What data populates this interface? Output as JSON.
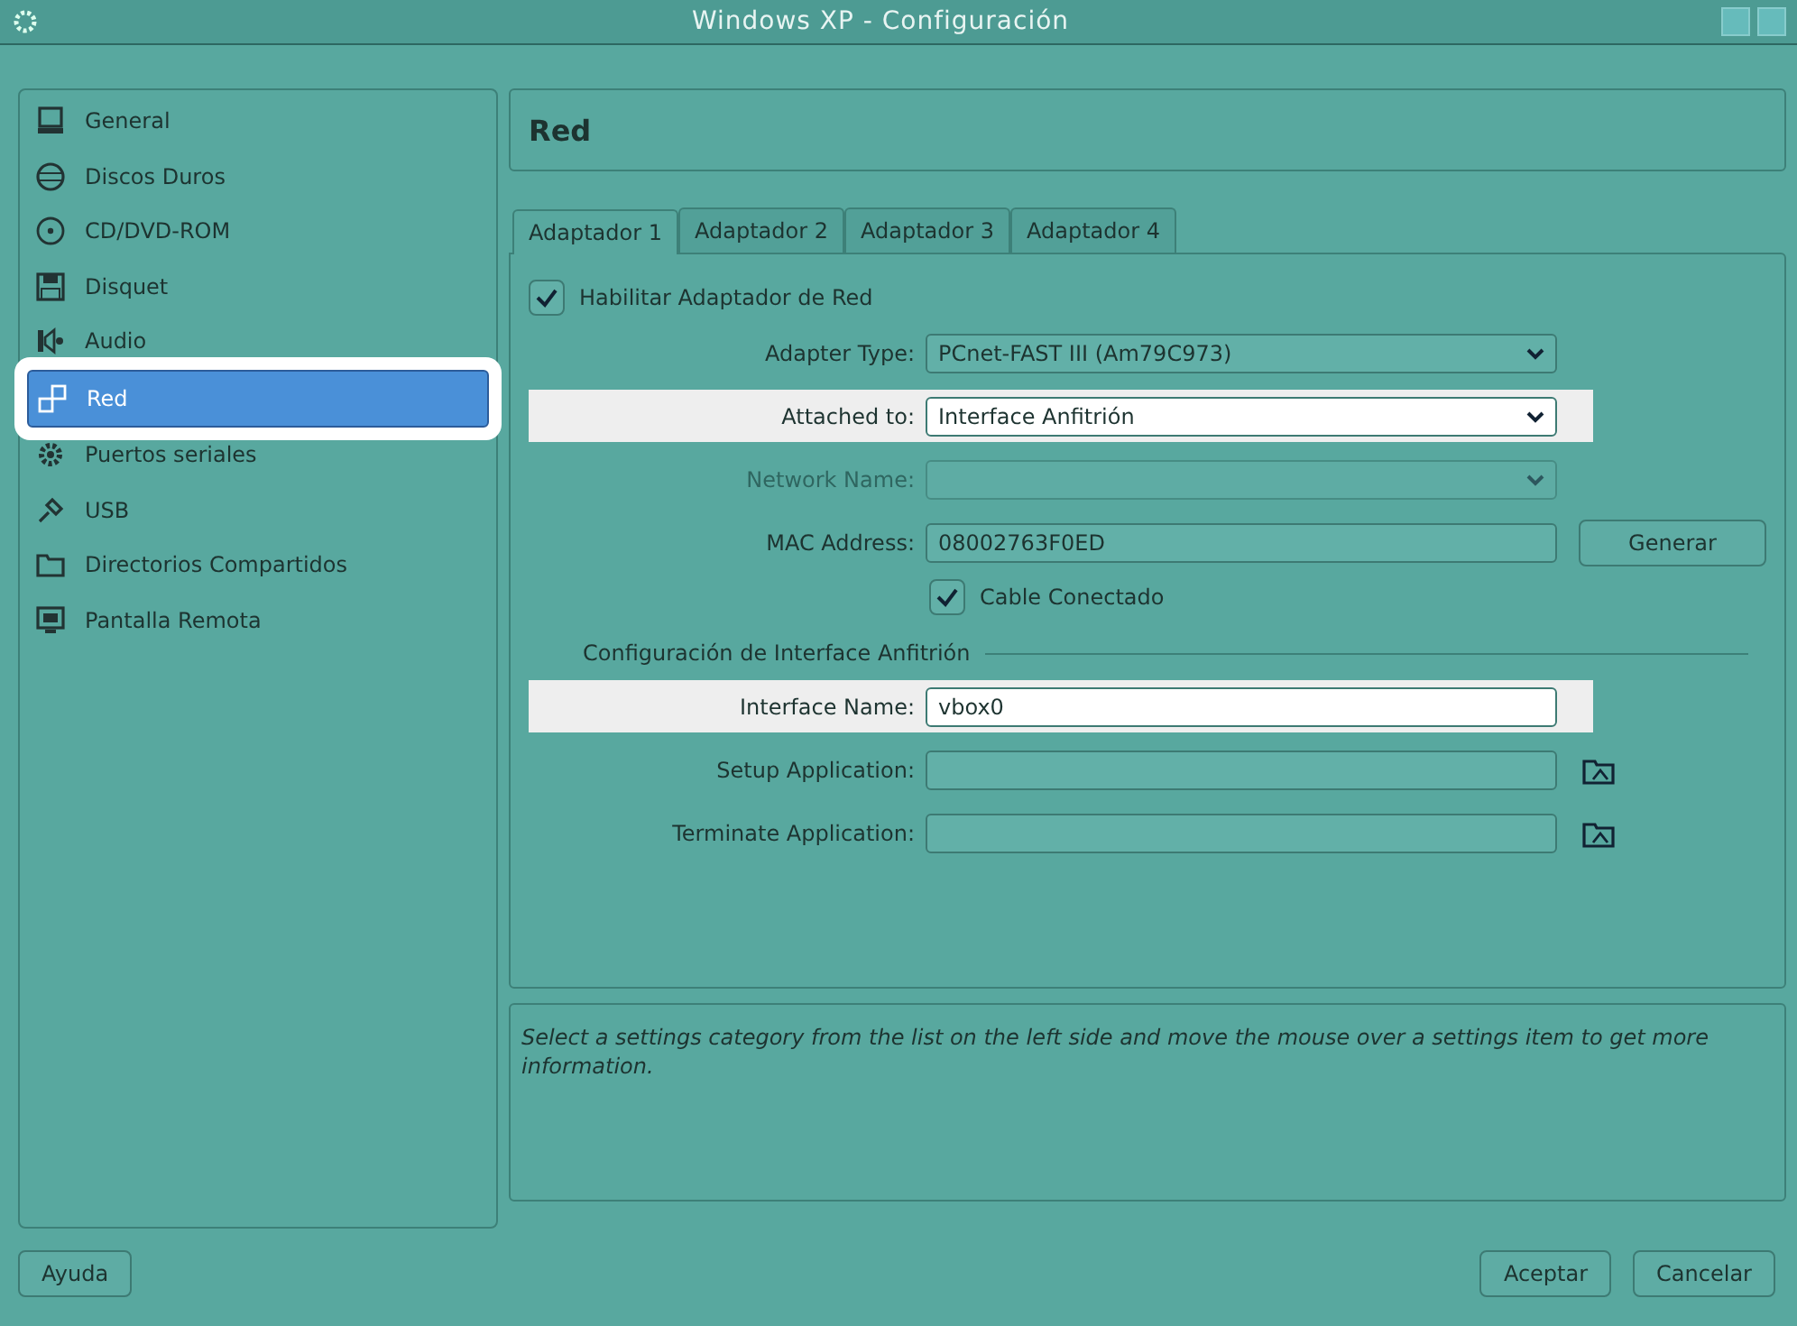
{
  "window": {
    "title": "Windows XP - Configuración"
  },
  "sidebar": {
    "items": [
      {
        "label": "General",
        "selected": false
      },
      {
        "label": "Discos Duros",
        "selected": false
      },
      {
        "label": "CD/DVD-ROM",
        "selected": false
      },
      {
        "label": "Disquet",
        "selected": false
      },
      {
        "label": "Audio",
        "selected": false
      },
      {
        "label": "Red",
        "selected": true
      },
      {
        "label": "Puertos seriales",
        "selected": false
      },
      {
        "label": "USB",
        "selected": false
      },
      {
        "label": "Directorios Compartidos",
        "selected": false
      },
      {
        "label": "Pantalla Remota",
        "selected": false
      }
    ]
  },
  "page_title": "Red",
  "tabs": [
    {
      "label": "Adaptador 1",
      "selected": true
    },
    {
      "label": "Adaptador 2",
      "selected": false
    },
    {
      "label": "Adaptador 3",
      "selected": false
    },
    {
      "label": "Adaptador 4",
      "selected": false
    }
  ],
  "enable_adapter": {
    "label": "Habilitar Adaptador de Red",
    "checked": true
  },
  "fields": [
    {
      "kind": "dropdown",
      "label": "Adapter Type:",
      "value": "PCnet-FAST III (Am79C973)",
      "disabled": false,
      "highlighted": false
    },
    {
      "kind": "dropdown",
      "label": "Attached to:",
      "value": "Interface Anfitrión",
      "disabled": false,
      "highlighted": true
    },
    {
      "kind": "dropdown",
      "label": "Network Name:",
      "disabled": true,
      "highlighted": false
    },
    {
      "kind": "text",
      "label": "MAC Address:",
      "value": "08002763F0ED",
      "disabled": false,
      "highlighted": false,
      "button": "Generar"
    }
  ],
  "cable": {
    "label": "Cable Conectado",
    "checked": true
  },
  "host_group": {
    "title": "Configuración de Interface Anfitrión",
    "fields": [
      {
        "kind": "text",
        "label": "Interface Name:",
        "value": "vbox0",
        "disabled": false,
        "highlighted": true
      },
      {
        "kind": "file",
        "label": "Setup Application:",
        "disabled": false,
        "highlighted": false
      },
      {
        "kind": "file",
        "label": "Terminate Application:",
        "disabled": false,
        "highlighted": false
      }
    ]
  },
  "description": "Select a settings category from the list on the left side and move the mouse over a settings item to get more information.",
  "buttons": {
    "help": "Ayuda",
    "ok": "Aceptar",
    "cancel": "Cancelar"
  }
}
